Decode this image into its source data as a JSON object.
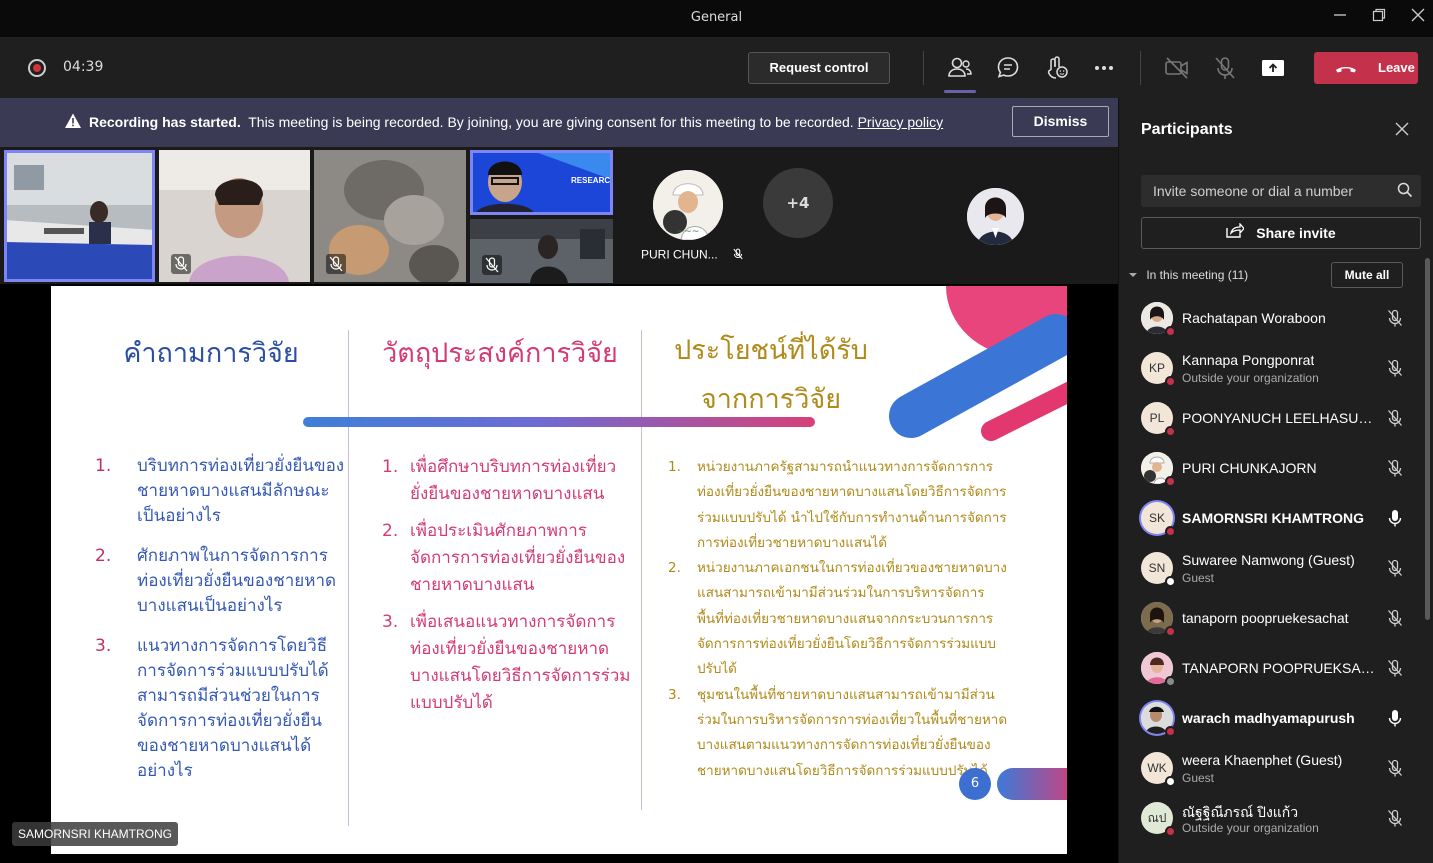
{
  "window": {
    "title": "General"
  },
  "topbar": {
    "timer": "04:39",
    "request_control": "Request control",
    "leave": "Leave"
  },
  "banner": {
    "bold": "Recording has started.",
    "text": "This meeting is being recorded. By joining, you are giving consent for this meeting to be recorded.",
    "link": "Privacy policy",
    "dismiss": "Dismiss"
  },
  "strip": {
    "overflow": "+4",
    "puri_label": "PURI CHUN...",
    "tile_banner": "RESEARC"
  },
  "stage": {
    "speaker_tag": "SAMORNSRI KHAMTRONG",
    "slide": {
      "col1_title": "คำถามการวิจัย",
      "col2_title": "วัตถุประสงค์การวิจัย",
      "col3_title_line1": "ประโยชน์ที่ได้รับ",
      "col3_title_line2": "จากการวิจัย",
      "col1_items": [
        {
          "num": "1.",
          "text": "บริบทการท่องเที่ยวยั่งยืนของชายหาดบางแสนมีลักษณะเป็นอย่างไร"
        },
        {
          "num": "2.",
          "text": "ศักยภาพในการจัดการการท่องเที่ยวยั่งยืนของชายหาดบางแสนเป็นอย่างไร"
        },
        {
          "num": "3.",
          "text": "แนวทางการจัดการโดยวิธีการจัดการร่วมแบบปรับได้สามารถมีส่วนช่วยในการจัดการการท่องเที่ยวยั่งยืนของชายหาดบางแสนได้อย่างไร"
        }
      ],
      "col2_items": [
        {
          "num": "1.",
          "text": "เพื่อศึกษาบริบทการท่องเที่ยวยั่งยืนของชายหาดบางแสน"
        },
        {
          "num": "2.",
          "text": "เพื่อประเมินศักยภาพการจัดการการท่องเที่ยวยั่งยืนของชายหาดบางแสน"
        },
        {
          "num": "3.",
          "text": "เพื่อเสนอแนวทางการจัดการท่องเที่ยวยั่งยืนของชายหาดบางแสนโดยวิธีการจัดการร่วมแบบปรับได้"
        }
      ],
      "col3_items": [
        {
          "num": "1.",
          "text": "หน่วยงานภาครัฐสามารถนำแนวทางการจัดการการท่องเที่ยวยั่งยืนของชายหาดบางแสนโดยวิธีการจัดการร่วมแบบปรับได้ นำไปใช้กับการทำงานด้านการจัดการการท่องเที่ยวชายหาดบางแสนได้"
        },
        {
          "num": "2.",
          "text": "หน่วยงานภาคเอกชนในการท่องเที่ยวของชายหาดบางแสนสามารถเข้ามามีส่วนร่วมในการบริหารจัดการพื้นที่ท่องเที่ยวชายหาดบางแสนจากกระบวนการการจัดการการท่องเที่ยวยั่งยืนโดยวิธีการจัดการร่วมแบบปรับได้"
        },
        {
          "num": "3.",
          "text": "ชุมชนในพื้นที่ชายหาดบางแสนสามารถเข้ามามีส่วนร่วมในการบริหารจัดการการท่องเที่ยวในพื้นที่ชายหาดบางแสนตามแนวทางการจัดการท่องเที่ยวยั่งยืนของชายหาดบางแสนโดยวิธีการจัดการร่วมแบบปรับได้"
        }
      ],
      "page_number": "6"
    }
  },
  "panel": {
    "title": "Participants",
    "invite_placeholder": "Invite someone or dial a number",
    "share_invite": "Share invite",
    "section_label": "In this meeting (11)",
    "mute_all": "Mute all",
    "participants": [
      {
        "name": "Rachatapan Woraboon",
        "sub": "",
        "initials": "",
        "mic": "muted",
        "status": "busy",
        "speaking": false
      },
      {
        "name": "Kannapa Pongponrat",
        "sub": "Outside your organization",
        "initials": "KP",
        "mic": "muted",
        "status": "busy",
        "speaking": false
      },
      {
        "name": "POONYANUCH LEELHASUWAN",
        "sub": "",
        "initials": "PL",
        "mic": "muted",
        "status": "busy",
        "speaking": false
      },
      {
        "name": "PURI CHUNKAJORN",
        "sub": "",
        "initials": "",
        "mic": "muted",
        "status": "busy",
        "speaking": false
      },
      {
        "name": "SAMORNSRI KHAMTRONG",
        "sub": "",
        "initials": "SK",
        "mic": "on",
        "status": "busy",
        "speaking": true
      },
      {
        "name": "Suwaree Namwong (Guest)",
        "sub": "Guest",
        "initials": "SN",
        "mic": "muted",
        "status": "available",
        "speaking": false
      },
      {
        "name": "tanaporn poopruekesachat",
        "sub": "",
        "initials": "",
        "mic": "muted",
        "status": "busy",
        "speaking": false
      },
      {
        "name": "TANAPORN POOPRUEKSACH...",
        "sub": "",
        "initials": "",
        "mic": "muted",
        "status": "offline",
        "speaking": false
      },
      {
        "name": "warach madhyamapurush",
        "sub": "",
        "initials": "",
        "mic": "on",
        "status": "busy",
        "speaking": true
      },
      {
        "name": "weera Khaenphet (Guest)",
        "sub": "Guest",
        "initials": "WK",
        "mic": "muted",
        "status": "available",
        "speaking": false
      },
      {
        "name": "ณัฐฐิณีภรณ์ ปิงแก้ว",
        "sub": "Outside your organization",
        "initials": "ณป",
        "mic": "muted",
        "status": "busy",
        "speaking": false
      }
    ]
  },
  "colors": {
    "accent": "#6264a7",
    "leave": "#c4314b",
    "banner": "#3b3a55",
    "slide_blue": "#2a4ea3",
    "slide_pink": "#d33a76",
    "slide_gold": "#b08a1a"
  }
}
